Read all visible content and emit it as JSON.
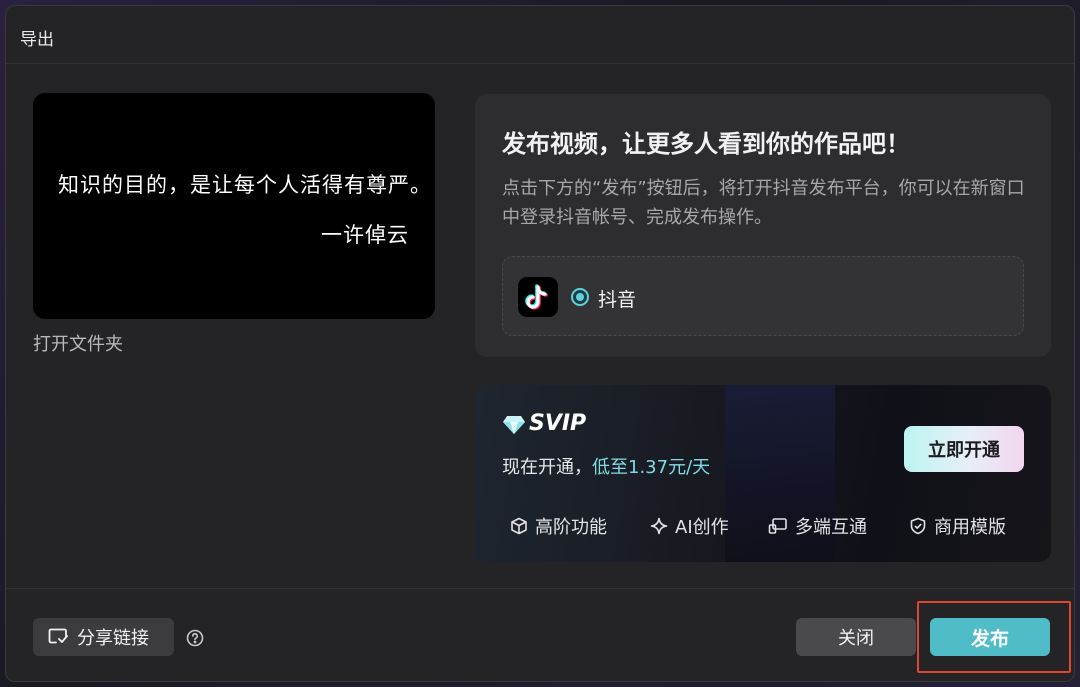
{
  "dialog": {
    "title": "导出"
  },
  "preview": {
    "quote": "知识的目的，是让每个人活得有尊严。",
    "author": "一许倬云",
    "open_folder_label": "打开文件夹"
  },
  "publish": {
    "heading": "发布视频，让更多人看到你的作品吧！",
    "description": "点击下方的“发布”按钮后，将打开抖音发布平台，你可以在新窗口中登录抖音帐号、完成发布操作。",
    "platform": {
      "name": "抖音",
      "icon": "tiktok-icon",
      "selected": true
    }
  },
  "svip": {
    "title": "SVIP",
    "price_prefix": "现在开通，",
    "price_highlight": "低至1.37元/天",
    "open_button_label": "立即开通",
    "features": [
      {
        "label": "高阶功能",
        "icon": "cube-icon"
      },
      {
        "label": "AI创作",
        "icon": "sparkle-icon"
      },
      {
        "label": "多端互通",
        "icon": "devices-icon"
      },
      {
        "label": "商用模版",
        "icon": "shield-check-icon"
      }
    ]
  },
  "footer": {
    "share_label": "分享链接",
    "close_label": "关闭",
    "publish_label": "发布"
  },
  "colors": {
    "accent": "#4fbcc8",
    "highlight_box": "#e0452f",
    "svip_price": "#7fdce6"
  }
}
